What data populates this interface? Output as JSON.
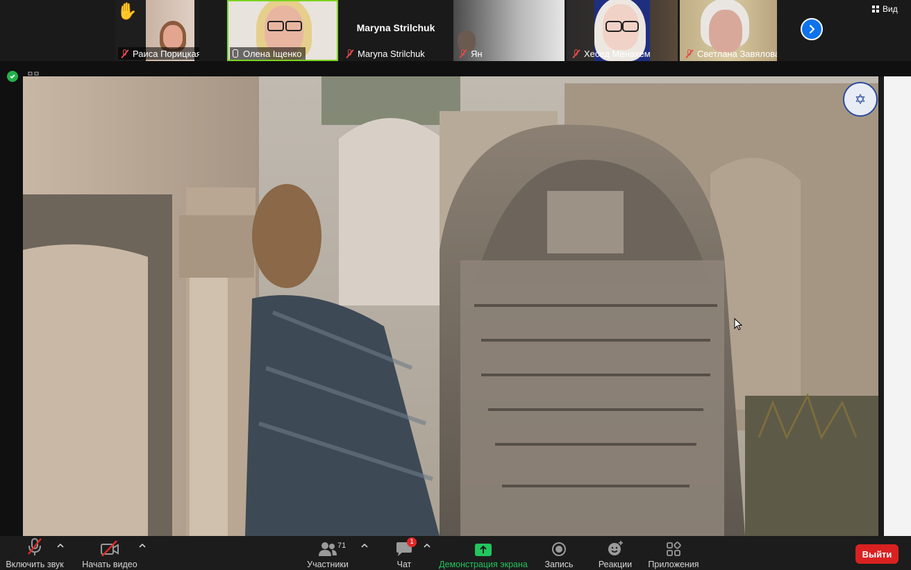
{
  "participants_strip": [
    {
      "name": "Раиса Порицкая",
      "muted": true,
      "raised_hand": true
    },
    {
      "name": "Олена Іщенко",
      "muted": false,
      "active_speaker": true
    },
    {
      "name": "Maryna Strilchuk",
      "muted": true,
      "video": false
    },
    {
      "name": "Ян",
      "muted": true
    },
    {
      "name": "Хесед Менахем",
      "muted": true
    },
    {
      "name": "Светлана Завялова",
      "muted": true
    }
  ],
  "header": {
    "view_label": "Вид"
  },
  "toolbar": {
    "mute_label": "Включить звук",
    "video_label": "Начать видео",
    "participants_label": "Участники",
    "participants_count": "71",
    "chat_label": "Чат",
    "chat_badge": "1",
    "share_label": "Демонстрация экрана",
    "record_label": "Запись",
    "reactions_label": "Реакции",
    "apps_label": "Приложения",
    "leave_label": "Выйти"
  },
  "colors": {
    "share_green": "#22c55e",
    "leave_red": "#d92121",
    "active_speaker_border": "#7ed321",
    "next_blue": "#0e72ed"
  }
}
